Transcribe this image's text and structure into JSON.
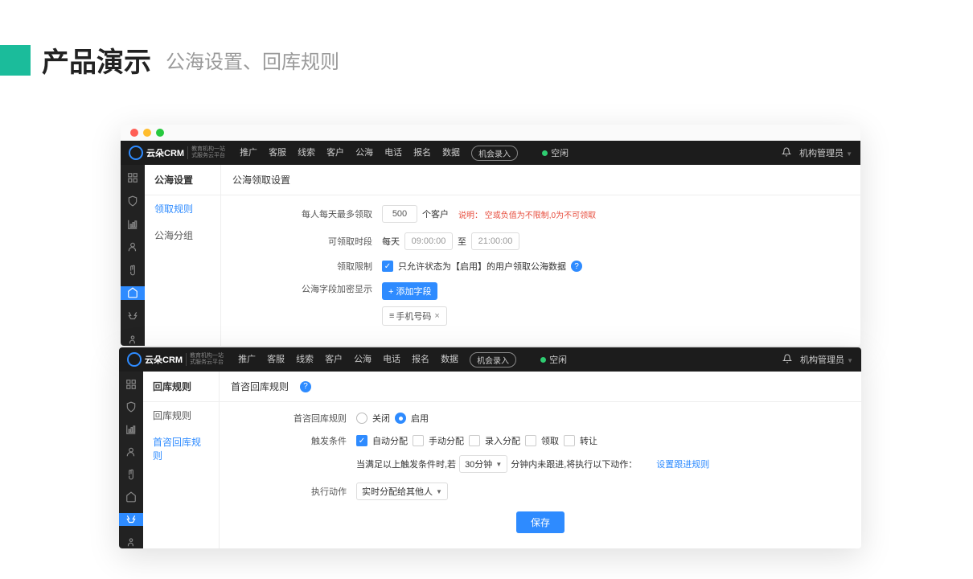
{
  "slide": {
    "title": "产品演示",
    "subtitle": "公海设置、回库规则"
  },
  "app": {
    "logo_text": "云朵CRM",
    "logo_sub1": "教育机构一站",
    "logo_sub2": "式服务云平台",
    "nav": [
      "推广",
      "客服",
      "线索",
      "客户",
      "公海",
      "电话",
      "报名",
      "数据"
    ],
    "nav_btn": "机会录入",
    "status": "空闲",
    "user": "机构管理员"
  },
  "win1": {
    "side_title": "公海设置",
    "side_items": [
      "领取规则",
      "公海分组"
    ],
    "content_title": "公海领取设置",
    "row1": {
      "label": "每人每天最多领取",
      "value": "500",
      "unit": "个客户",
      "hint": "说明： 空或负值为不限制,0为不可领取"
    },
    "row2": {
      "label": "可领取时段",
      "prefix": "每天",
      "from": "09:00:00",
      "to_label": "至",
      "to": "21:00:00"
    },
    "row3": {
      "label": "领取限制",
      "text": "只允许状态为【启用】的用户领取公海数据"
    },
    "row4": {
      "label": "公海字段加密显示",
      "btn": "+ 添加字段",
      "tag": "手机号码"
    }
  },
  "win2": {
    "side_title": "回库规则",
    "side_items": [
      "回库规则",
      "首咨回库规则"
    ],
    "content_title": "首咨回库规则",
    "row1": {
      "label": "首咨回库规则",
      "off": "关闭",
      "on": "启用"
    },
    "row2": {
      "label": "触发条件",
      "opts": [
        "自动分配",
        "手动分配",
        "录入分配",
        "领取",
        "转让"
      ]
    },
    "row2b": {
      "prefix": "当满足以上触发条件时,若",
      "select": "30分钟",
      "suffix": "分钟内未跟进,将执行以下动作：",
      "link": "设置跟进规则"
    },
    "row3": {
      "label": "执行动作",
      "select": "实时分配给其他人"
    },
    "save": "保存"
  }
}
